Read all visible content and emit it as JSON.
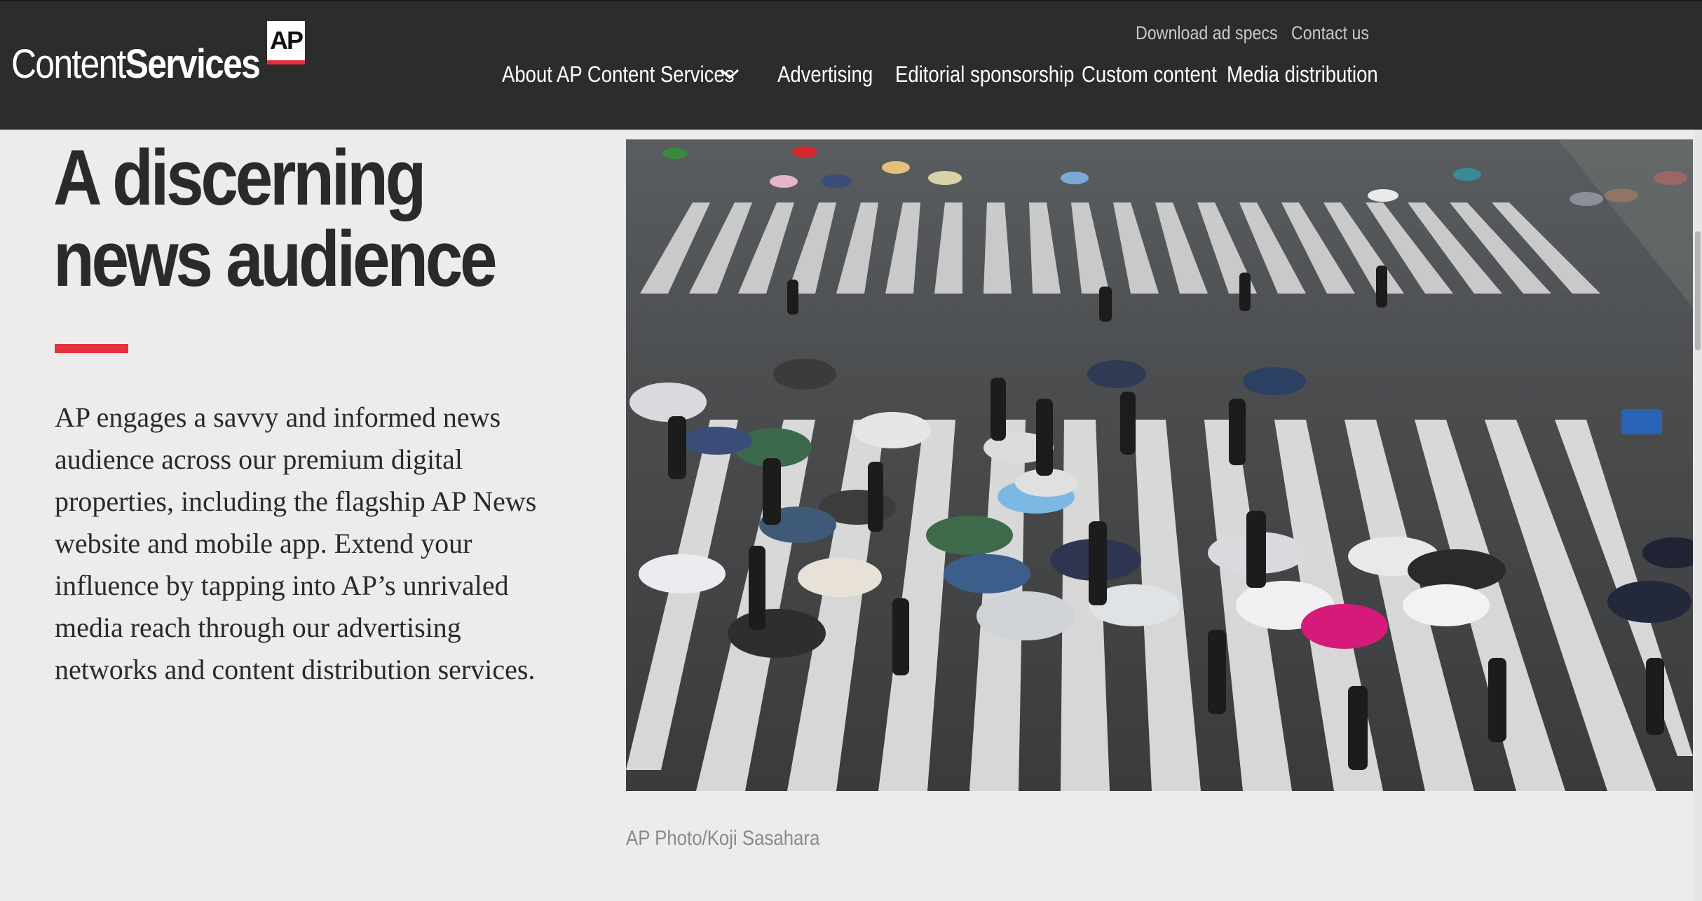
{
  "header": {
    "logo": {
      "word1": "Content",
      "word2": "Services",
      "badge": "AP"
    },
    "utility_links": {
      "ad_specs": "Download ad specs",
      "contact": "Contact us"
    },
    "nav": {
      "about": "About AP Content Services",
      "advertising": "Advertising",
      "editorial": "Editorial sponsorship",
      "custom": "Custom content",
      "media": "Media distribution"
    },
    "dropdown_icon": "chevron-down-icon"
  },
  "hero": {
    "headline_line1": "A discerning",
    "headline_line2": "news audience",
    "body": "AP engages a savvy and informed news audience across our premium digital properties, including the flagship AP News website and mobile app. Extend your influence by tapping into AP’s unrivaled media reach through our advertising networks and content distribution services."
  },
  "photo": {
    "caption": "AP Photo/Koji Sasahara"
  },
  "colors": {
    "header_bg": "#2c2c2c",
    "accent_red": "#e3323f",
    "page_bg": "#ececec",
    "text_dark": "#2a2a2a",
    "caption_gray": "#8a8a8a"
  }
}
